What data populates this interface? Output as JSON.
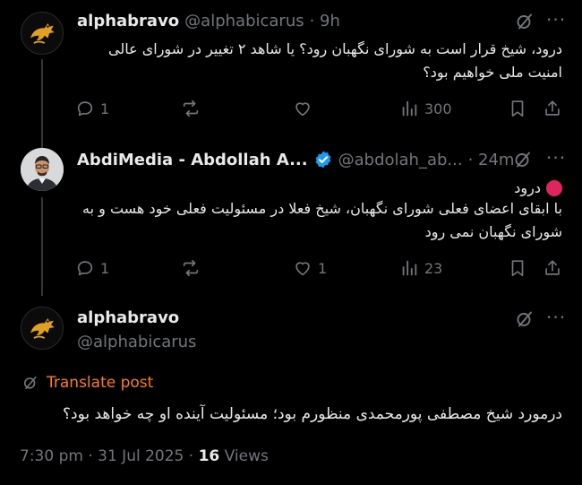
{
  "tweets": [
    {
      "name": "alphabravo",
      "handle": "@alphabicarus",
      "time": "· 9h",
      "text": "درود، شیخ قرار است به شورای نگهبان رود؟ یا شاهد ۲ تغییر در شورای عالی امنیت ملی خواهیم بود؟",
      "replies": "1",
      "retweets": "",
      "likes": "",
      "views": "300"
    },
    {
      "name": "AbdiMedia - Abdollah A...",
      "handle": "@abdolah_ab...",
      "time": "· 24m",
      "line1": "درود",
      "text": "با ابقای اعضای فعلی شورای نگهبان، شیخ فعلا در مسئولیت فعلی خود هست و به شورای نگهبان نمی رود",
      "replies": "1",
      "retweets": "",
      "likes": "1",
      "views": "23",
      "verified_color": "#1d9bf0"
    },
    {
      "name": "alphabravo",
      "handle": "@alphabicarus",
      "translate": "Translate post",
      "text": "درمورد شیخ مصطفی پورمحمدی منظورم بود؛ مسئولیت آینده او چه خواهد بود؟"
    }
  ],
  "meta": {
    "time": "7:30 pm · 31 Jul 2025 · ",
    "views_count": "16",
    "views_label": " Views"
  },
  "colors": {
    "accent": "#1d9bf0",
    "translate": "#ff7a1a",
    "muted": "#71767b",
    "red_dot": "#e0245e"
  },
  "icons": [
    "eagle-logo-avatar",
    "grok-icon",
    "more-icon",
    "reply-icon",
    "retweet-icon",
    "like-icon",
    "views-icon",
    "bookmark-icon",
    "share-icon",
    "verified-icon",
    "translate-icon"
  ]
}
